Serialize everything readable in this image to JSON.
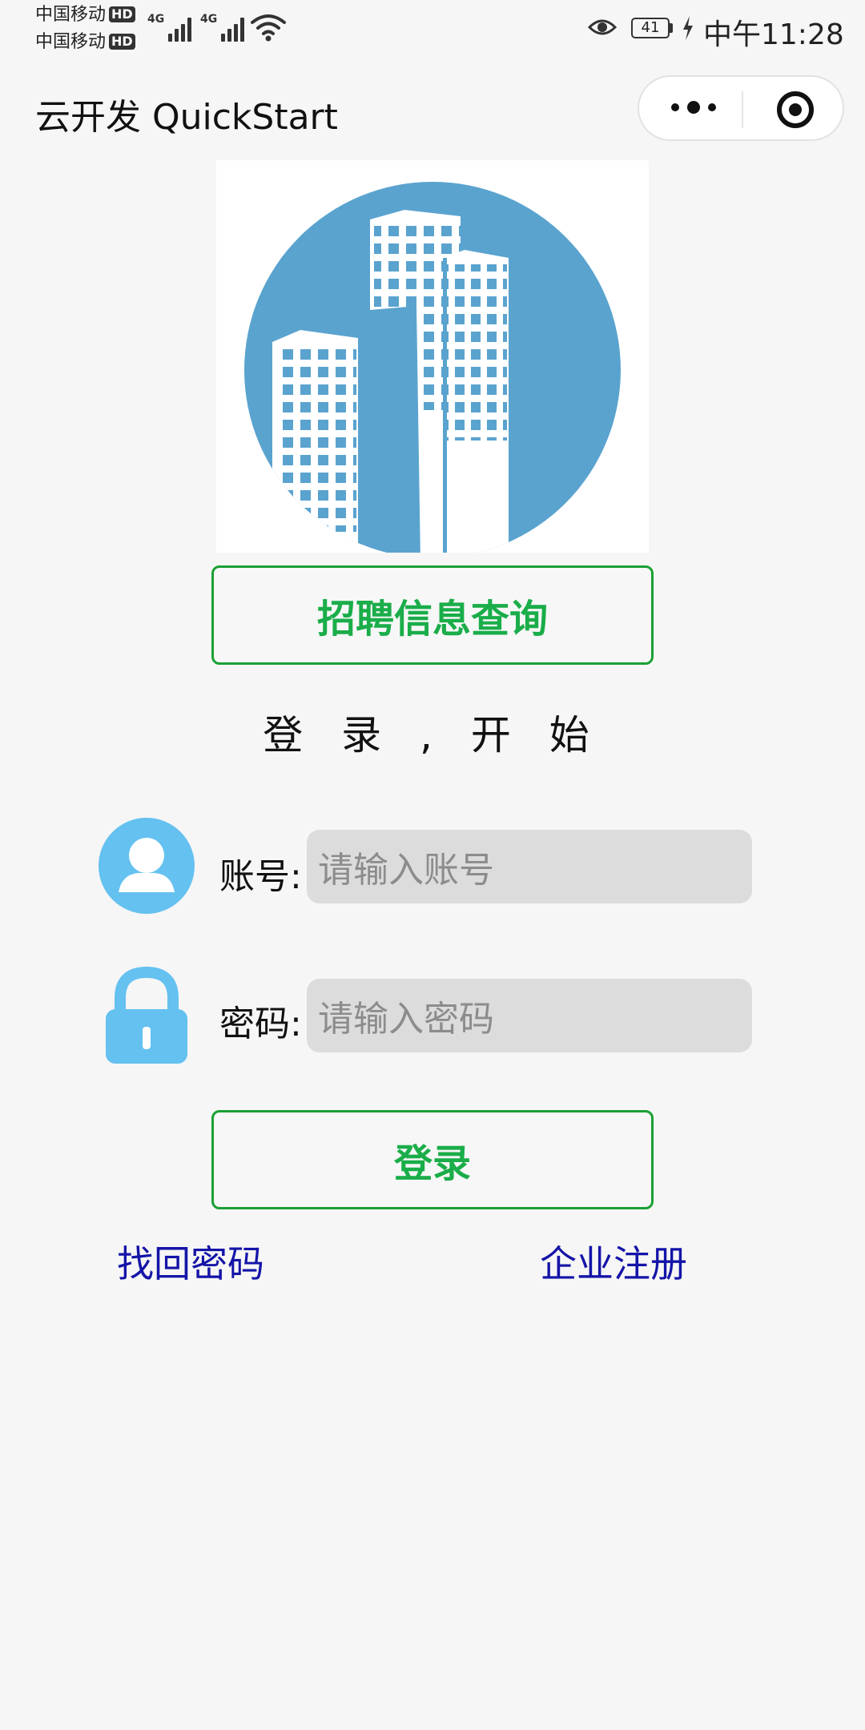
{
  "status_bar": {
    "carrier_1": "中国移动",
    "carrier_2": "中国移动",
    "hd_badge": "HD",
    "network_1": "4G",
    "network_2": "4G",
    "battery_level": "41",
    "time": "中午11:28"
  },
  "nav": {
    "title": "云开发 QuickStart"
  },
  "logo": {
    "icon": "city-buildings-icon",
    "circle_color": "#5aa3cf"
  },
  "job_search_button": {
    "label": "招聘信息查询"
  },
  "subtitle": "登 录 , 开 始",
  "account": {
    "label": "账号:",
    "placeholder": "请输入账号",
    "icon": "user-avatar-icon"
  },
  "password": {
    "label": "密码:",
    "placeholder": "请输入密码",
    "icon": "lock-icon"
  },
  "login_button": {
    "label": "登录"
  },
  "links": {
    "forgot_password": "找回密码",
    "company_register": "企业注册"
  },
  "colors": {
    "accent_green": "#1aad49",
    "link_blue": "#1414a8",
    "icon_blue": "#64c1f0"
  }
}
